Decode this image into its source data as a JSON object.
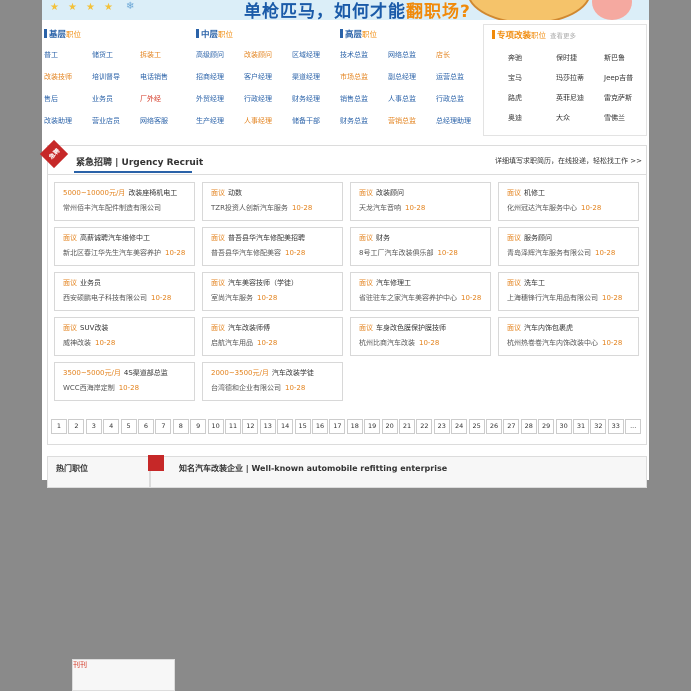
{
  "banner": {
    "slogan_main": "单枪匹马，如何才能",
    "slogan_highlight": "翻职场?"
  },
  "categories": [
    {
      "title": "基层",
      "sub": "职位",
      "items": [
        {
          "label": "普工",
          "tone": "blue"
        },
        {
          "label": "储货工",
          "tone": "blue"
        },
        {
          "label": "拆装工",
          "tone": "orange"
        },
        {
          "label": "改装技师",
          "tone": "orange"
        },
        {
          "label": "培训督导",
          "tone": "blue"
        },
        {
          "label": "电话销售",
          "tone": "blue"
        },
        {
          "label": "售后",
          "tone": "blue"
        },
        {
          "label": "业务员",
          "tone": "blue"
        },
        {
          "label": "厂外经",
          "tone": "red"
        },
        {
          "label": "改装助理",
          "tone": "blue"
        },
        {
          "label": "营业店员",
          "tone": "blue"
        },
        {
          "label": "网络客服",
          "tone": "blue"
        }
      ]
    },
    {
      "title": "中层",
      "sub": "职位",
      "items": [
        {
          "label": "高级顾问",
          "tone": "blue"
        },
        {
          "label": "改装顾问",
          "tone": "orange"
        },
        {
          "label": "区域经理",
          "tone": "blue"
        },
        {
          "label": "招商经理",
          "tone": "blue"
        },
        {
          "label": "客户经理",
          "tone": "blue"
        },
        {
          "label": "渠道经理",
          "tone": "blue"
        },
        {
          "label": "外贸经理",
          "tone": "blue"
        },
        {
          "label": "行政经理",
          "tone": "blue"
        },
        {
          "label": "财务经理",
          "tone": "blue"
        },
        {
          "label": "生产经理",
          "tone": "blue"
        },
        {
          "label": "人事经理",
          "tone": "orange"
        },
        {
          "label": "储备干部",
          "tone": "blue"
        }
      ]
    },
    {
      "title": "高层",
      "sub": "职位",
      "items": [
        {
          "label": "技术总监",
          "tone": "blue"
        },
        {
          "label": "网络总监",
          "tone": "blue"
        },
        {
          "label": "店长",
          "tone": "orange"
        },
        {
          "label": "市场总监",
          "tone": "orange"
        },
        {
          "label": "副总经理",
          "tone": "blue"
        },
        {
          "label": "运营总监",
          "tone": "blue"
        },
        {
          "label": "销售总监",
          "tone": "blue"
        },
        {
          "label": "人事总监",
          "tone": "blue"
        },
        {
          "label": "行政总监",
          "tone": "blue"
        },
        {
          "label": "财务总监",
          "tone": "blue"
        },
        {
          "label": "营销总监",
          "tone": "orange"
        },
        {
          "label": "总经理助理",
          "tone": "blue"
        }
      ]
    }
  ],
  "special": {
    "title": "专项改装",
    "sub": "职位",
    "more": "查看更多",
    "items": [
      "奔驰",
      "保时捷",
      "斯巴鲁",
      "宝马",
      "玛莎拉蒂",
      "Jeep吉普",
      "路虎",
      "英菲尼迪",
      "雷克萨斯",
      "奥迪",
      "大众",
      "雪佛兰"
    ]
  },
  "urgent": {
    "badge": "急聘",
    "title": "紧急招聘 | Urgency Recruit",
    "link": "详细填写求职简历，在线投递，轻松找工作 >>",
    "cards": [
      {
        "tag": "5000~10000元/月",
        "title": "改装座椅机电工",
        "company": "常州佰丰汽车配件制造有限公司",
        "date": "",
        "hot": "刊刊"
      },
      {
        "tag": "面议",
        "title": "动数",
        "company": "TZR投资人创新汽车服务",
        "date": "10-28",
        "hot": ""
      },
      {
        "tag": "面议",
        "title": "改装顾问",
        "company": "天龙汽车音响",
        "date": "10-28",
        "hot": ""
      },
      {
        "tag": "面议",
        "title": "机修工",
        "company": "化州冠达汽车服务中心",
        "date": "10-28",
        "hot": ""
      },
      {
        "tag": "面议",
        "title": "高薪诚聘汽车维修中工",
        "company": "新北区春江华先生汽车美容养护",
        "date": "10-28",
        "hot": ""
      },
      {
        "tag": "面议",
        "title": "普吾县华汽车修配美招聘",
        "company": "普吾县华汽车修配美容",
        "date": "10-28",
        "hot": ""
      },
      {
        "tag": "面议",
        "title": "财务",
        "company": "8号工厂汽车改装俱乐部",
        "date": "10-28",
        "hot": ""
      },
      {
        "tag": "面议",
        "title": "服务顾问",
        "company": "青岛泽辉汽车服务有限公司",
        "date": "10-28",
        "hot": ""
      },
      {
        "tag": "面议",
        "title": "业务员",
        "company": "西安硕鹏电子科技有限公司",
        "date": "10-28",
        "hot": ""
      },
      {
        "tag": "面议",
        "title": "汽车美容技师（学徒）",
        "company": "室尚汽车服务",
        "date": "10-28",
        "hot": ""
      },
      {
        "tag": "面议",
        "title": "汽车修理工",
        "company": "省驻驻车之家汽车美容养护中心",
        "date": "10-28",
        "hot": ""
      },
      {
        "tag": "面议",
        "title": "洗车工",
        "company": "上海穗锋行汽车用品有限公司",
        "date": "10-28",
        "hot": ""
      },
      {
        "tag": "面议",
        "title": "SUV改装",
        "company": "威神改装",
        "date": "10-28",
        "hot": ""
      },
      {
        "tag": "面议",
        "title": "汽车改装师傅",
        "company": "启航汽车用品",
        "date": "10-28",
        "hot": ""
      },
      {
        "tag": "面议",
        "title": "车身改色膜保护膜技师",
        "company": "杭州比商汽车改装",
        "date": "10-28",
        "hot": ""
      },
      {
        "tag": "面议",
        "title": "汽车内饰包裹虎",
        "company": "杭州热卷卷汽车内饰改装中心",
        "date": "10-28",
        "hot": ""
      },
      {
        "tag": "3500~5000元/月",
        "title": "4S渠道部总监",
        "company": "WCC西海岸定制",
        "date": "10-28",
        "hot": ""
      },
      {
        "tag": "2000~3500元/月",
        "title": "汽车改装学徒",
        "company": "台湾德和企业有限公司",
        "date": "10-28",
        "hot": ""
      }
    ],
    "pages": [
      "1",
      "2",
      "3",
      "4",
      "5",
      "6",
      "7",
      "8",
      "9",
      "10",
      "11",
      "12",
      "13",
      "14",
      "15",
      "16",
      "17",
      "18",
      "19",
      "20",
      "21",
      "22",
      "23",
      "24",
      "25",
      "26",
      "27",
      "28",
      "29",
      "30",
      "31",
      "32",
      "33",
      "..."
    ]
  },
  "hot_jobs": {
    "title": "热门职位"
  },
  "enterprise": {
    "title": "知名汽车改装企业 | Well-known automobile refitting enterprise"
  }
}
